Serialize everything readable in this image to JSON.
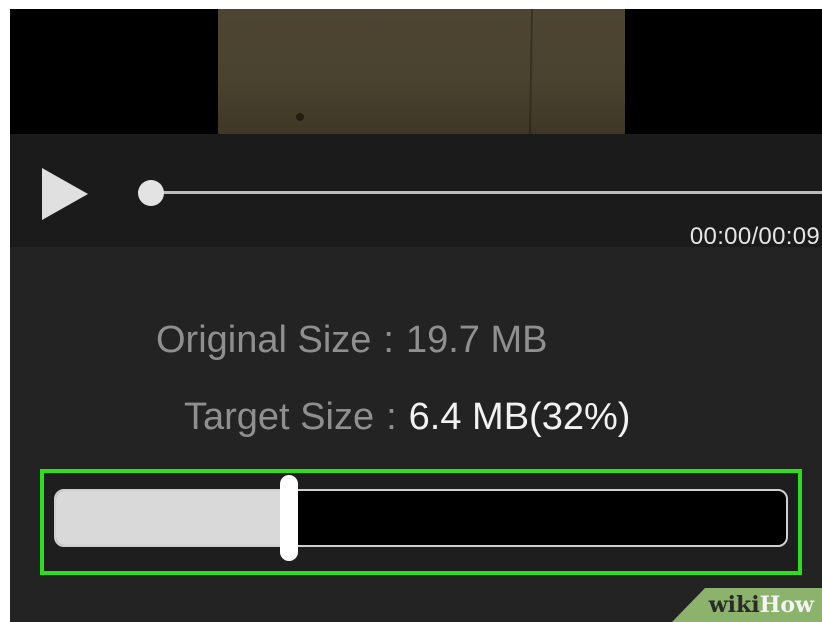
{
  "player": {
    "playback_progress": 0,
    "time_text": "00:00/00:09"
  },
  "compression": {
    "original_label": "Original Size",
    "original_value": "19.7 MB",
    "target_label": "Target Size",
    "target_value": "6.4 MB(32%)",
    "separator": ":",
    "target_ratio": 0.32
  },
  "icons": {
    "play": "play-icon"
  },
  "colors": {
    "highlight": "#2ede1c",
    "panel_bg": "#232323",
    "controls_bg": "#1b1b1b"
  },
  "watermark": {
    "part1": "wiki",
    "part2": "How"
  }
}
